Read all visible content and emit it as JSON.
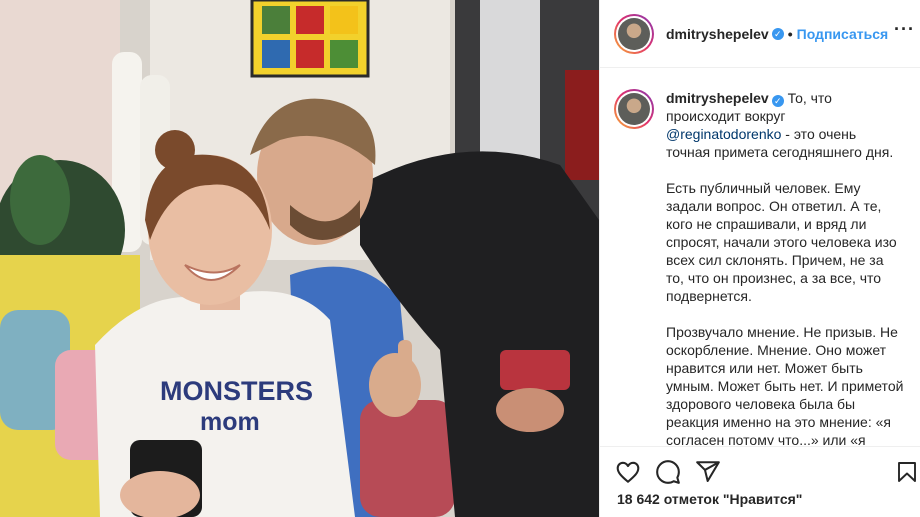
{
  "post": {
    "username": "dmitryshepelev",
    "follow_label": "Подписаться",
    "separator": "•",
    "more_label": "···",
    "verified_mark": "✓",
    "shirt_line1": "MONSTERS",
    "shirt_line2": "mom"
  },
  "caption": {
    "lead": " То, что происходит вокруг ",
    "mention": "@reginatodorenko",
    "rest": " - это очень точная примета сегодняшнего дня.",
    "paragraph2": "Есть публичный человек. Ему задали вопрос. Он ответил. А те, кого не спрашивали, и вряд ли спросят, начали этого человека изо всех сил склонять. Причем, не за то, что он произнес, а за все, что подвернется.",
    "paragraph3": "Прозвучало мнение. Не призыв. Не оскорбление. Мнение. Оно может нравится или нет. Может быть умным. Может быть нет. И приметой здорового человека была бы реакция именно на это мнение: «я согласен потому что...» или «я"
  },
  "likes": {
    "text": "18 642 отметок \"Нравится\""
  },
  "icons": [
    "heart-icon",
    "comment-icon",
    "share-icon",
    "bookmark-icon"
  ],
  "colors": {
    "link": "#3897f0",
    "mention": "#00376b",
    "verified": "#3897f0"
  }
}
